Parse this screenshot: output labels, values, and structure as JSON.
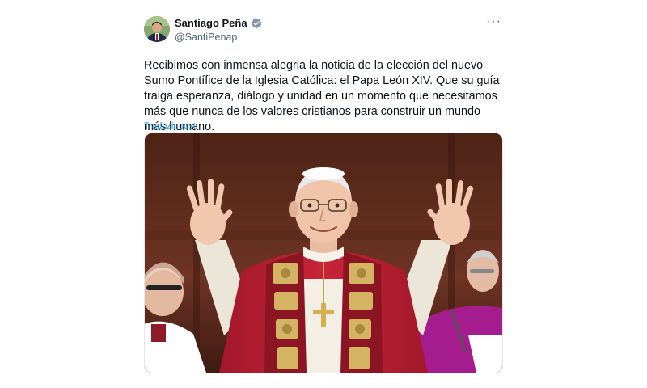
{
  "author": {
    "display_name": "Santiago Peña",
    "handle": "@SantiPenap",
    "verified": true,
    "avatar_icon": "profile-photo"
  },
  "post": {
    "text": "Recibimos con inmensa alegria la noticia de la elección del nuevo Sumo Pontífice de la Iglesia Católica: el Papa León XIV. Que su guía traiga esperanza, diálogo y unidad en un momento que necesitamos más que nunca de los valores cristianos para construir un mundo más humano.",
    "translate_label": "Traduzir post",
    "more_icon": "more-icon"
  },
  "colors": {
    "link": "#1d9bf0",
    "verified_badge": "#829aab",
    "text": "#0f1419",
    "secondary_text": "#536471"
  }
}
